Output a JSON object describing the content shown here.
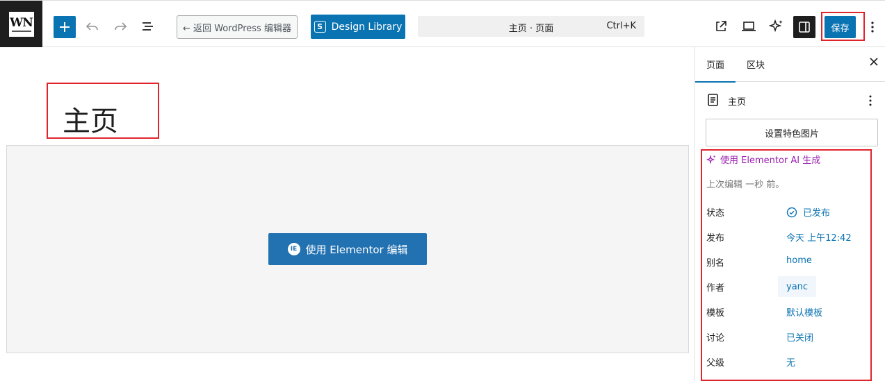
{
  "toolbar": {
    "logo_text": "WN",
    "back_label": "← 返回 WordPress 编辑器",
    "design_library_label": "Design Library",
    "command_title": "主页 · 页面",
    "command_shortcut": "Ctrl+K",
    "save_label": "保存"
  },
  "canvas": {
    "page_title": "主页",
    "elementor_button": "使用 Elementor 编辑"
  },
  "sidebar": {
    "tabs": [
      "页面",
      "区块"
    ],
    "page_name": "主页",
    "featured_image_button": "设置特色图片",
    "ai_link": "使用 Elementor AI 生成",
    "last_edit": "上次编辑 一秒 前。",
    "meta": [
      {
        "key": "状态",
        "value": "已发布"
      },
      {
        "key": "发布",
        "value": "今天 上午12:42"
      },
      {
        "key": "别名",
        "value": "home"
      },
      {
        "key": "作者",
        "value": "yanc"
      },
      {
        "key": "模板",
        "value": "默认模板"
      },
      {
        "key": "讨论",
        "value": "已关闭"
      },
      {
        "key": "父级",
        "value": "无"
      }
    ]
  },
  "colors": {
    "accent": "#0a73b2",
    "highlight_outline": "#e0242c",
    "ai_purple": "#9b1fb0"
  }
}
